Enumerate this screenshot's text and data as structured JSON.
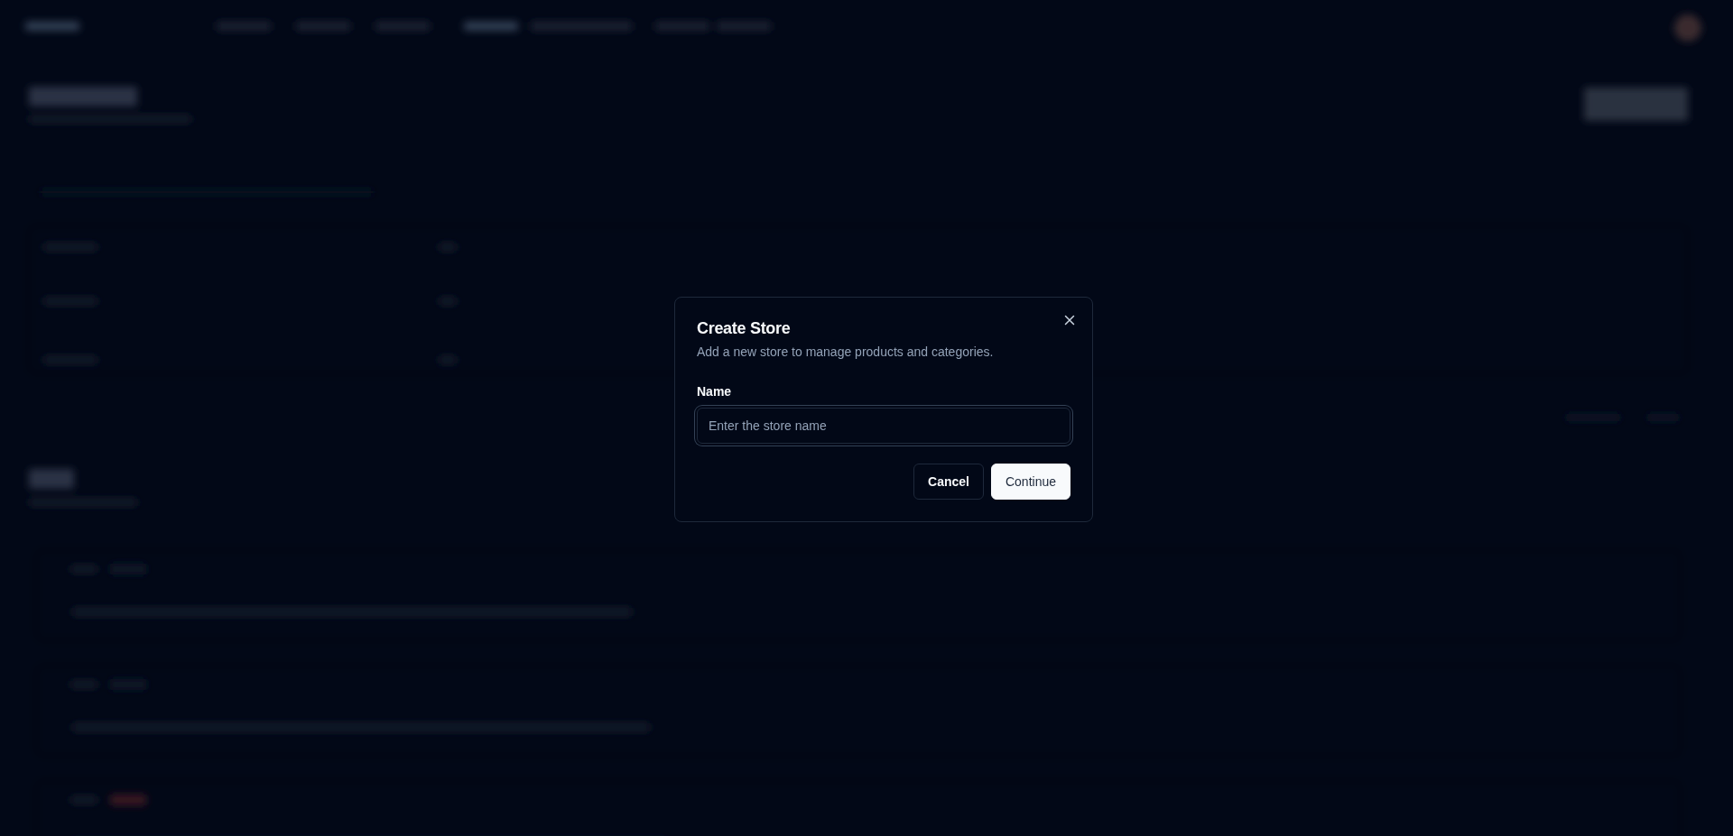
{
  "dialog": {
    "title": "Create Store",
    "description": "Add a new store to manage products and categories.",
    "field": {
      "label": "Name",
      "placeholder": "Enter the store name"
    },
    "buttons": [
      {
        "label": "Cancel",
        "kind": "outline"
      },
      {
        "label": "Continue",
        "kind": "primary"
      }
    ]
  }
}
